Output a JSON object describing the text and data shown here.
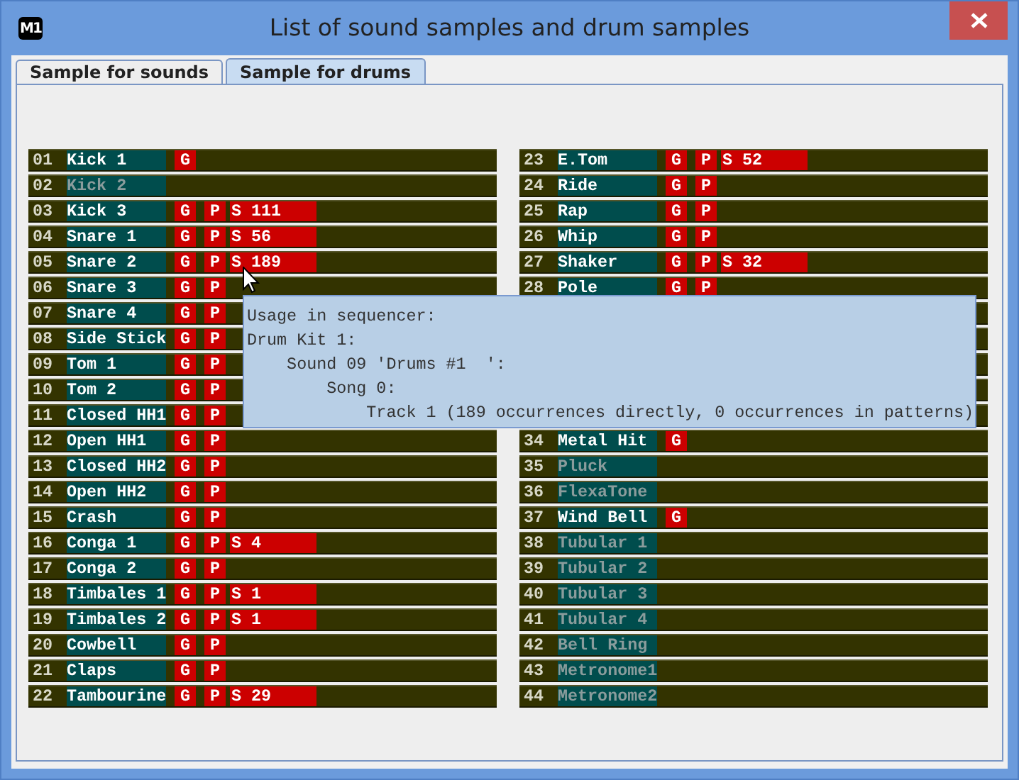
{
  "window": {
    "title": "List of sound samples and drum samples",
    "app_icon": "M1"
  },
  "tabs": [
    {
      "label": "Sample for sounds",
      "selected": false
    },
    {
      "label": "Sample for drums",
      "selected": true
    }
  ],
  "columns": [
    {
      "rows": [
        {
          "kind": "sample",
          "number": "01",
          "name": "Kick 1",
          "enabled": true,
          "badges": [
            "G"
          ]
        },
        {
          "kind": "sample",
          "number": "02",
          "name": "Kick 2",
          "enabled": false,
          "badges": []
        },
        {
          "kind": "sample",
          "number": "03",
          "name": "Kick 3",
          "enabled": true,
          "badges": [
            "G",
            "P",
            "S 111"
          ]
        },
        {
          "kind": "sample",
          "number": "04",
          "name": "Snare 1",
          "enabled": true,
          "badges": [
            "G",
            "P",
            "S 56"
          ]
        },
        {
          "kind": "sample",
          "number": "05",
          "name": "Snare 2",
          "enabled": true,
          "badges": [
            "G",
            "P",
            "S 189"
          ]
        },
        {
          "kind": "sample",
          "number": "06",
          "name": "Snare 3",
          "enabled": true,
          "badges": [
            "G",
            "P"
          ]
        },
        {
          "kind": "sample",
          "number": "07",
          "name": "Snare 4",
          "enabled": true,
          "badges": [
            "G",
            "P"
          ]
        },
        {
          "kind": "sample",
          "number": "08",
          "name": "Side Stick",
          "enabled": true,
          "badges": [
            "G",
            "P"
          ]
        },
        {
          "kind": "sample",
          "number": "09",
          "name": "Tom 1",
          "enabled": true,
          "badges": [
            "G",
            "P"
          ]
        },
        {
          "kind": "sample",
          "number": "10",
          "name": "Tom 2",
          "enabled": true,
          "badges": [
            "G",
            "P"
          ]
        },
        {
          "kind": "sample",
          "number": "11",
          "name": "Closed HH1",
          "enabled": true,
          "badges": [
            "G",
            "P"
          ]
        },
        {
          "kind": "sample",
          "number": "12",
          "name": "Open HH1",
          "enabled": true,
          "badges": [
            "G",
            "P"
          ]
        },
        {
          "kind": "sample",
          "number": "13",
          "name": "Closed HH2",
          "enabled": true,
          "badges": [
            "G",
            "P"
          ]
        },
        {
          "kind": "sample",
          "number": "14",
          "name": "Open HH2",
          "enabled": true,
          "badges": [
            "G",
            "P"
          ]
        },
        {
          "kind": "sample",
          "number": "15",
          "name": "Crash",
          "enabled": true,
          "badges": [
            "G",
            "P"
          ]
        },
        {
          "kind": "sample",
          "number": "16",
          "name": "Conga 1",
          "enabled": true,
          "badges": [
            "G",
            "P",
            "S 4"
          ]
        },
        {
          "kind": "sample",
          "number": "17",
          "name": "Conga 2",
          "enabled": true,
          "badges": [
            "G",
            "P"
          ]
        },
        {
          "kind": "sample",
          "number": "18",
          "name": "Timbales 1",
          "enabled": true,
          "badges": [
            "G",
            "P",
            "S 1"
          ]
        },
        {
          "kind": "sample",
          "number": "19",
          "name": "Timbales 2",
          "enabled": true,
          "badges": [
            "G",
            "P",
            "S 1"
          ]
        },
        {
          "kind": "sample",
          "number": "20",
          "name": "Cowbell",
          "enabled": true,
          "badges": [
            "G",
            "P"
          ]
        },
        {
          "kind": "sample",
          "number": "21",
          "name": "Claps",
          "enabled": true,
          "badges": [
            "G",
            "P"
          ]
        },
        {
          "kind": "sample",
          "number": "22",
          "name": "Tambourine",
          "enabled": true,
          "badges": [
            "G",
            "P",
            "S 29"
          ]
        }
      ]
    },
    {
      "rows": [
        {
          "kind": "sample",
          "number": "23",
          "name": "E.Tom",
          "enabled": true,
          "badges": [
            "G",
            "P",
            "S 52"
          ]
        },
        {
          "kind": "sample",
          "number": "24",
          "name": "Ride",
          "enabled": true,
          "badges": [
            "G",
            "P"
          ]
        },
        {
          "kind": "sample",
          "number": "25",
          "name": "Rap",
          "enabled": true,
          "badges": [
            "G",
            "P"
          ]
        },
        {
          "kind": "sample",
          "number": "26",
          "name": "Whip",
          "enabled": true,
          "badges": [
            "G",
            "P"
          ]
        },
        {
          "kind": "sample",
          "number": "27",
          "name": "Shaker",
          "enabled": true,
          "badges": [
            "G",
            "P",
            "S 32"
          ]
        },
        {
          "kind": "sample",
          "number": "28",
          "name": "Pole",
          "enabled": true,
          "badges": [
            "G",
            "P"
          ]
        },
        {
          "kind": "covered"
        },
        {
          "kind": "covered"
        },
        {
          "kind": "covered"
        },
        {
          "kind": "covered"
        },
        {
          "kind": "covered"
        },
        {
          "kind": "sample",
          "number": "34",
          "name": "Metal Hit",
          "enabled": true,
          "badges": [
            "G"
          ]
        },
        {
          "kind": "sample",
          "number": "35",
          "name": "Pluck",
          "enabled": false,
          "badges": []
        },
        {
          "kind": "sample",
          "number": "36",
          "name": "FlexaTone",
          "enabled": false,
          "badges": []
        },
        {
          "kind": "sample",
          "number": "37",
          "name": "Wind Bell",
          "enabled": true,
          "badges": [
            "G"
          ]
        },
        {
          "kind": "sample",
          "number": "38",
          "name": "Tubular 1",
          "enabled": false,
          "badges": []
        },
        {
          "kind": "sample",
          "number": "39",
          "name": "Tubular 2",
          "enabled": false,
          "badges": []
        },
        {
          "kind": "sample",
          "number": "40",
          "name": "Tubular 3",
          "enabled": false,
          "badges": []
        },
        {
          "kind": "sample",
          "number": "41",
          "name": "Tubular 4",
          "enabled": false,
          "badges": []
        },
        {
          "kind": "sample",
          "number": "42",
          "name": "Bell Ring",
          "enabled": false,
          "badges": []
        },
        {
          "kind": "sample",
          "number": "43",
          "name": "Metronome1",
          "enabled": false,
          "badges": []
        },
        {
          "kind": "sample",
          "number": "44",
          "name": "Metronome2",
          "enabled": false,
          "badges": []
        }
      ]
    }
  ],
  "tooltip": {
    "lines": [
      "Usage in sequencer:",
      "Drum Kit 1:",
      "    Sound 09 'Drums #1  ':",
      "        Song 0:",
      "            Track 1 (189 occurrences directly, 0 occurrences in patterns)"
    ]
  }
}
